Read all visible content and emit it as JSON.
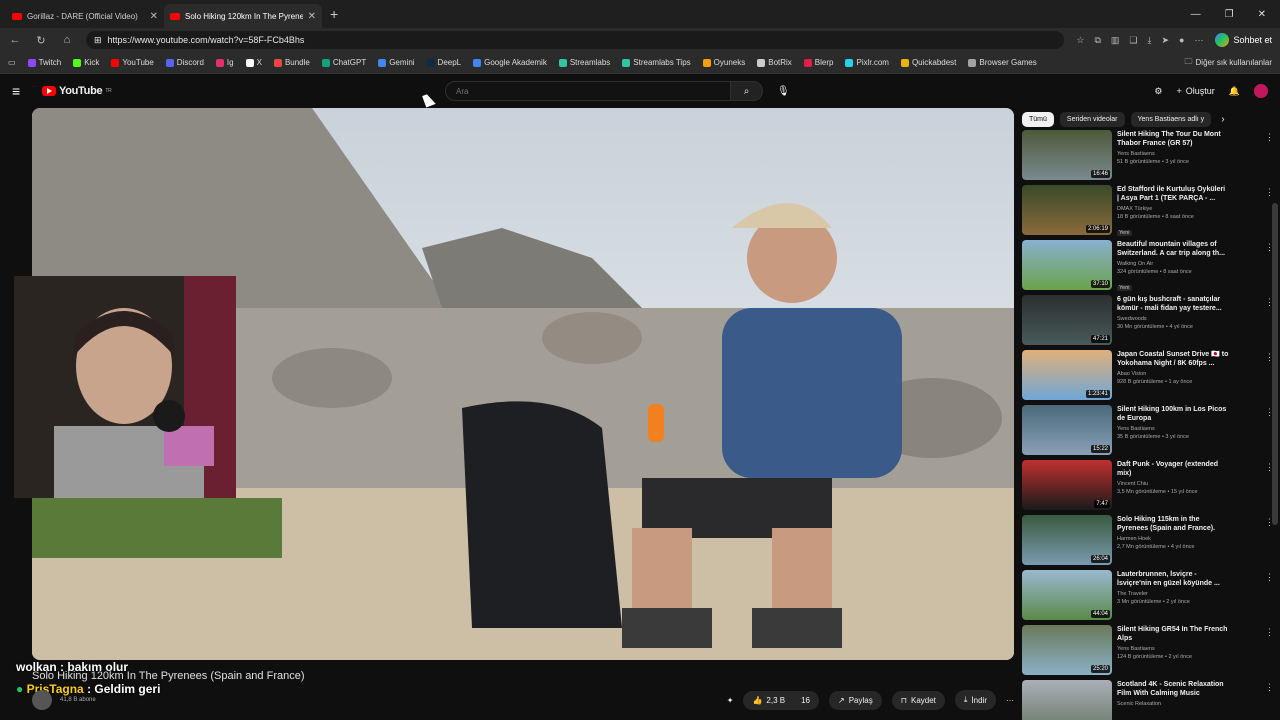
{
  "browser": {
    "tabs": [
      {
        "label": "Gorillaz - DARE (Official Video)",
        "active": false
      },
      {
        "label": "Solo Hiking 120km In The Pyrenees",
        "active": true
      }
    ],
    "url": "https://www.youtube.com/watch?v=58F-FCb4Bhs",
    "chat_button": "Sohbet et",
    "bookmarks": [
      {
        "label": "Twitch",
        "color": "#9146ff"
      },
      {
        "label": "Kick",
        "color": "#53fc18"
      },
      {
        "label": "YouTube",
        "color": "#ff0000"
      },
      {
        "label": "Discord",
        "color": "#5865f2"
      },
      {
        "label": "Ig",
        "color": "#e1306c"
      },
      {
        "label": "X",
        "color": "#ffffff"
      },
      {
        "label": "Bundle",
        "color": "#ef4444"
      },
      {
        "label": "ChatGPT",
        "color": "#10a37f"
      },
      {
        "label": "Gemini",
        "color": "#4285f4"
      },
      {
        "label": "DeepL",
        "color": "#0f2b46"
      },
      {
        "label": "Google Akademik",
        "color": "#4285f4"
      },
      {
        "label": "Streamlabs",
        "color": "#31c3a2"
      },
      {
        "label": "Streamlabs Tips",
        "color": "#31c3a2"
      },
      {
        "label": "Oyuneks",
        "color": "#f59e0b"
      },
      {
        "label": "BotRix",
        "color": "#cccccc"
      },
      {
        "label": "Blerp",
        "color": "#e11d48"
      },
      {
        "label": "Pixlr.com",
        "color": "#22d3ee"
      },
      {
        "label": "Quickabdest",
        "color": "#eab308"
      },
      {
        "label": "Browser Games",
        "color": "#a3a3a3"
      }
    ],
    "other_bookmarks": "Diğer sık kullanılanlar"
  },
  "youtube": {
    "logo": "YouTube",
    "logo_sup": "TR",
    "search_placeholder": "Ara",
    "create_label": "Oluştur",
    "video_title": "Solo Hiking 120km In The Pyrenees (Spain and France)",
    "subscribers": "41,8 B abone",
    "actions": {
      "likes": "2,3 B",
      "comments": "16",
      "share": "Paylaş",
      "save": "Kaydet",
      "download": "İndir"
    },
    "chips": [
      "Tümü",
      "Seriden videolar",
      "Yens Bastiaens adlı y"
    ],
    "recommendations": [
      {
        "title": "Silent Hiking The Tour Du Mont Thabor France (GR 57)",
        "channel": "Yens Bastiaens",
        "meta": "51 B görüntüleme • 3 yıl önce",
        "duration": "16:46",
        "badge": "",
        "color1": "#7a8a8f",
        "color2": "#4d5a3a"
      },
      {
        "title": "Ed Stafford ile Kurtuluş Öyküleri | Asya Part 1 (TEK PARÇA - ...",
        "channel": "DMAX Türkiye",
        "meta": "18 B görüntüleme • 8 saat önce",
        "duration": "2:06:19",
        "badge": "Yeni",
        "color1": "#8a6a3a",
        "color2": "#3a4a2a"
      },
      {
        "title": "Beautiful mountain villages of Switzerland. A car trip along th...",
        "channel": "Walking On Air",
        "meta": "324 görüntüleme • 8 saat önce",
        "duration": "37:10",
        "badge": "Yeni",
        "color1": "#6aa34a",
        "color2": "#8ab0d0"
      },
      {
        "title": "6 gün kış bushcraft - sanatçılar kömür - mali fidan yay testere...",
        "channel": "Swedwoods",
        "meta": "30 Mn görüntüleme • 4 yıl önce",
        "duration": "47:21",
        "badge": "",
        "color1": "#4a5a5a",
        "color2": "#2a3030"
      },
      {
        "title": "Japan Coastal Sunset Drive 🇯🇵 to Yokohama Night / 8K 60fps ...",
        "channel": "Abao Vision",
        "meta": "928 B görüntüleme • 1 ay önce",
        "duration": "1:23:41",
        "badge": "",
        "color1": "#6fa6d6",
        "color2": "#e0b07a"
      },
      {
        "title": "Silent Hiking 100km in Los Picos de Europa",
        "channel": "Yens Bastiaens",
        "meta": "35 B görüntüleme • 3 yıl önce",
        "duration": "15:22",
        "badge": "",
        "color1": "#8aa0b8",
        "color2": "#4a6a7a"
      },
      {
        "title": "Daft Punk - Voyager (extended mix)",
        "channel": "Vincent Chiu",
        "meta": "3,5 Mn görüntüleme • 15 yıl önce",
        "duration": "7:47",
        "badge": "",
        "color1": "#1a1a1a",
        "color2": "#c03030"
      },
      {
        "title": "Solo Hiking 115km in the Pyrenees (Spain and France).",
        "channel": "Harmen Hoek",
        "meta": "2,7 Mn görüntüleme • 4 yıl önce",
        "duration": "26:04",
        "badge": "",
        "color1": "#7a9ab0",
        "color2": "#3a5a40"
      },
      {
        "title": "Lauterbrunnen, İsviçre - İsviçre'nin en güzel köyünde ...",
        "channel": "The Traveler",
        "meta": "3 Mn görüntüleme • 2 yıl önce",
        "duration": "44:04",
        "badge": "",
        "color1": "#5a8a4a",
        "color2": "#9ab8d0"
      },
      {
        "title": "Silent Hiking GR54 In The French Alps",
        "channel": "Yens Bastiaens",
        "meta": "124 B görüntüleme • 2 yıl önce",
        "duration": "25:20",
        "badge": "",
        "color1": "#8ab0c8",
        "color2": "#6a7a5a"
      },
      {
        "title": "Scotland 4K - Scenic Relaxation Film With Calming Music",
        "channel": "Scenic Relaxation",
        "meta": "",
        "duration": "",
        "badge": "",
        "color1": "#6a7a6a",
        "color2": "#aab0b8"
      }
    ]
  },
  "stream_overlay": {
    "chat": [
      {
        "user": "wolkan",
        "message": "bakım olur"
      },
      {
        "user": "PrisTagna",
        "message": "Geldim geri"
      }
    ]
  }
}
